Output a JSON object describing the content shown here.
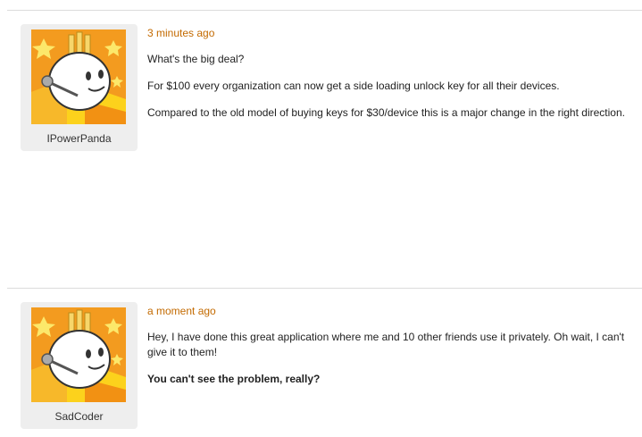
{
  "comments": [
    {
      "author": "IPowerPanda",
      "timestamp": "3 minutes ago",
      "avatar_icon": "lightbulb-robot-avatar-icon",
      "paragraphs": [
        {
          "text": "What's the big deal?",
          "bold": false
        },
        {
          "text": "For $100 every organization can now get a side loading unlock key for all their devices.",
          "bold": false
        },
        {
          "text": "Compared to the old model of buying keys for $30/device this is a major change in the right direction.",
          "bold": false
        }
      ]
    },
    {
      "author": "SadCoder",
      "timestamp": "a moment ago",
      "avatar_icon": "lightbulb-robot-avatar-icon",
      "paragraphs": [
        {
          "text": "Hey, I have done this great application where me and 10 other friends use it privately. Oh wait, I can't give it to them!",
          "bold": false
        },
        {
          "text": "You can't see the problem, really?",
          "bold": true
        }
      ]
    }
  ],
  "colors": {
    "timestamp": "#c36a00",
    "card_background": "#eeeeee",
    "avatar_orange": "#f39b1f",
    "avatar_yellow": "#fcd21c"
  }
}
